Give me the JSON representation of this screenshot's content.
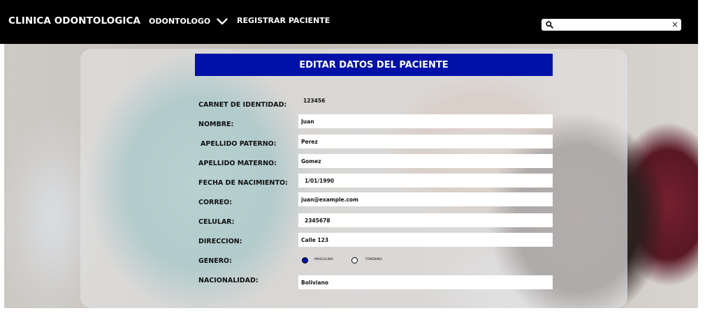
{
  "header": {
    "brand": "CLINICA ODONTOLOGICA",
    "nav_odontologo": "ODONTOLOGO",
    "nav_registrar": "REGISTRAR PACIENTE",
    "search": {
      "value": "",
      "placeholder": ""
    },
    "clear_glyph": "×"
  },
  "form": {
    "title": "EDITAR DATOS DEL PACIENTE",
    "carnet_label": "CARNET DE IDENTIDAD:",
    "carnet_value": "123456",
    "nombre_label": "NOMBRE:",
    "nombre_value": "Juan",
    "apellido_paterno_label": "APELLIDO PATERNO:",
    "apellido_paterno_value": "Perez",
    "apellido_materno_label": "APELLIDO MATERNO:",
    "apellido_materno_value": "Gomez",
    "fecha_label": "FECHA DE NACIMIENTO:",
    "fecha_value": "1/01/1990",
    "correo_label": "CORREO:",
    "correo_value": "juan@example.com",
    "celular_label": "CELULAR:",
    "celular_value": "2345678",
    "direccion_label": "DIRECCION:",
    "direccion_value": "Calle 123",
    "genero_label": "GENERO:",
    "genero_options": [
      "MASCULINO",
      "FEMENINO"
    ],
    "genero_selected": "MASCULINO",
    "nacionalidad_label": "NACIONALIDAD:",
    "nacionalidad_value": "Boliviano"
  },
  "colors": {
    "header_bg": "#000000",
    "title_bg": "#0011a8",
    "accent": "#0011a8"
  }
}
